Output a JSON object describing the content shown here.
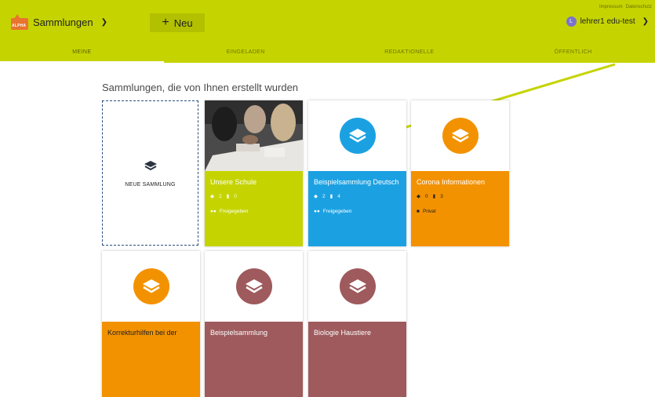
{
  "header": {
    "brand_tag": "ALPHA",
    "title": "Sammlungen",
    "new_label": "Neu",
    "links": [
      "Impressum",
      "Datenschutz"
    ],
    "user_initial": "L",
    "user_name": "lehrer1 edu-test"
  },
  "tabs": [
    "MEINE",
    "EINGELADEN",
    "REDAKTIONELLE",
    "ÖFFENTLICH"
  ],
  "main": {
    "heading": "Sammlungen, die von Ihnen erstellt wurden",
    "new_collection_label": "NEUE SAMMLUNG"
  },
  "collections": [
    {
      "title": "Unsere Schule",
      "count_a": "2",
      "count_b": "0",
      "status": "Freigegeben",
      "color": "#c5d400"
    },
    {
      "title": "Beispielsammlung Deutsch",
      "count_a": "2",
      "count_b": "4",
      "status": "Freigegeben",
      "color": "#1ba1e2"
    },
    {
      "title": "Corona Informationen",
      "count_a": "0",
      "count_b": "3",
      "status": "Privat",
      "color": "#f39200"
    },
    {
      "title": "Korrekturhilfen bei der",
      "color": "#f39200"
    },
    {
      "title": "Beispielsammlung",
      "color": "#9e5a5c"
    },
    {
      "title": "Biologie Haustiere",
      "color": "#9e5a5c"
    }
  ],
  "colors": {
    "topbar": "#c5d400",
    "new_border": "#2b4e7e"
  }
}
